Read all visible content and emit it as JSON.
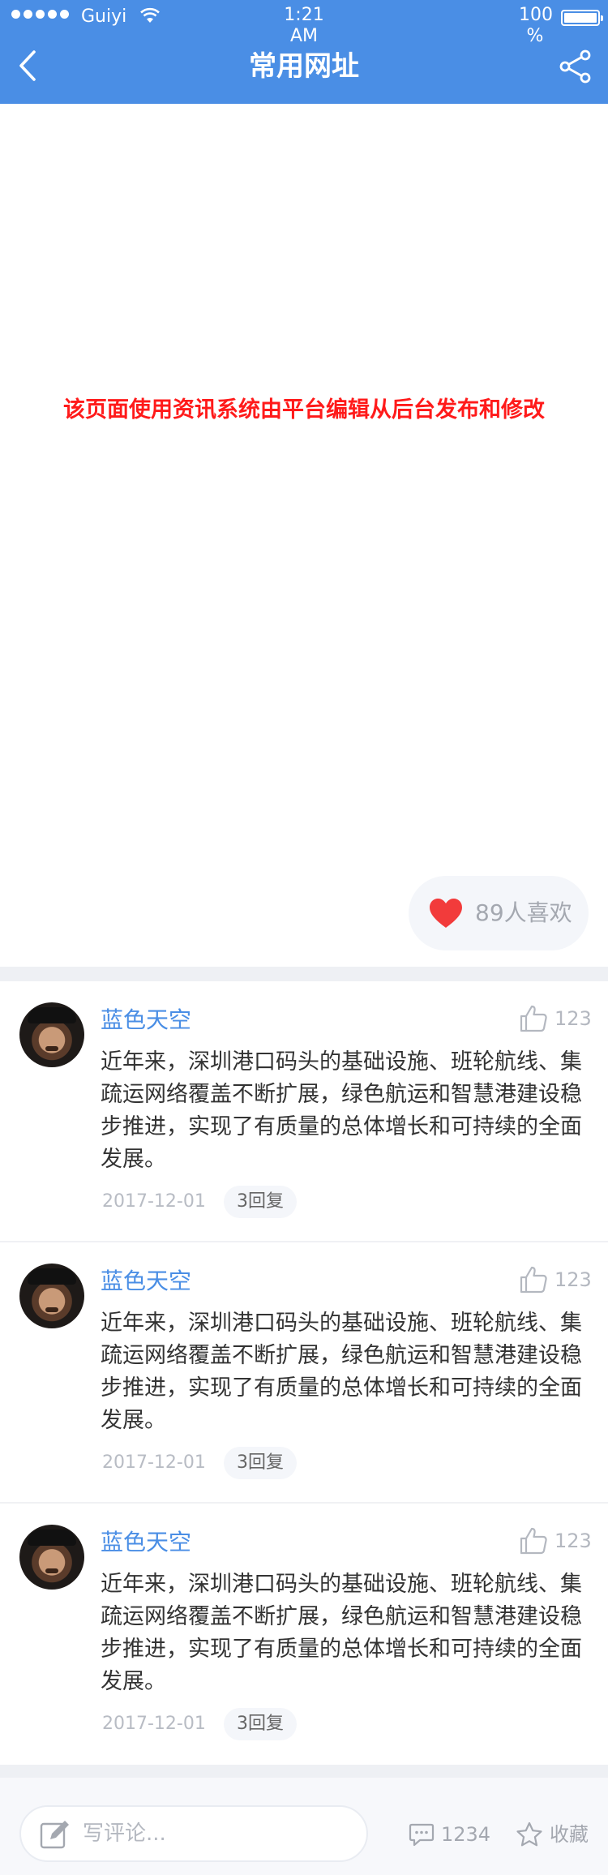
{
  "status_bar": {
    "carrier": "Guiyi",
    "time_line1": "1:21",
    "time_line2": "AM",
    "battery_line1": "100",
    "battery_line2": "%"
  },
  "nav": {
    "title": "常用网址"
  },
  "content": {
    "notice": "该页面使用资讯系统由平台编辑从后台发布和修改"
  },
  "likes": {
    "label": "89人喜欢"
  },
  "comments": [
    {
      "author": "蓝色天空",
      "likes": "123",
      "text": "近年来，深圳港口码头的基础设施、班轮航线、集疏运网络覆盖不断扩展，绿色航运和智慧港建设稳步推进，实现了有质量的总体增长和可持续的全面发展。",
      "date": "2017-12-01",
      "replies": "3回复"
    },
    {
      "author": "蓝色天空",
      "likes": "123",
      "text": "近年来，深圳港口码头的基础设施、班轮航线、集疏运网络覆盖不断扩展，绿色航运和智慧港建设稳步推进，实现了有质量的总体增长和可持续的全面发展。",
      "date": "2017-12-01",
      "replies": "3回复"
    },
    {
      "author": "蓝色天空",
      "likes": "123",
      "text": "近年来，深圳港口码头的基础设施、班轮航线、集疏运网络覆盖不断扩展，绿色航运和智慧港建设稳步推进，实现了有质量的总体增长和可持续的全面发展。",
      "date": "2017-12-01",
      "replies": "3回复"
    }
  ],
  "bottom_bar": {
    "input_placeholder": "写评论...",
    "comment_count": "1234",
    "favorite_label": "收藏"
  },
  "colors": {
    "header_bg": "#4a8ee5",
    "accent_blue": "#4a8ee5",
    "notice_red": "#ff1a1a",
    "heart_red": "#f23b3b"
  },
  "icons": {
    "back": "chevron-left-icon",
    "share": "share-icon",
    "like": "heart-icon",
    "thumb": "thumbs-up-icon",
    "edit": "pencil-icon",
    "comments": "comment-bubble-icon",
    "favorite": "star-icon"
  }
}
